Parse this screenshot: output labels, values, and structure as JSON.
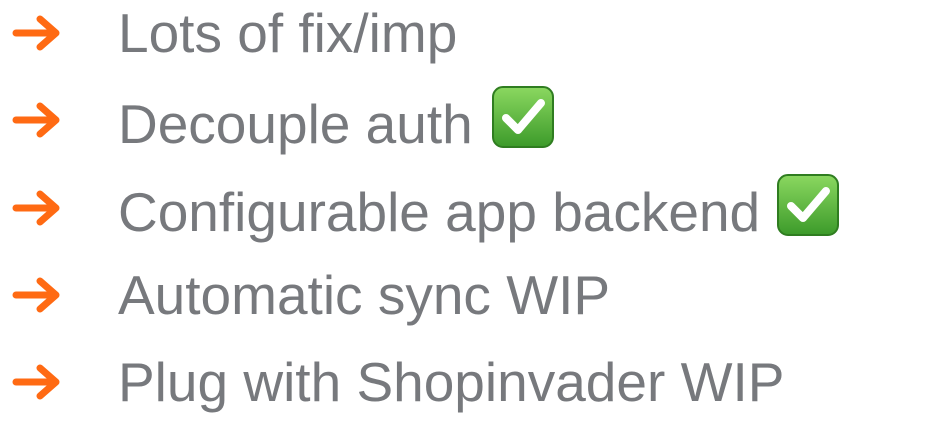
{
  "colors": {
    "arrow": "#ff6a13",
    "text": "#77797d",
    "check_box_top": "#7fd057",
    "check_box_bottom": "#3e9e2b",
    "check_mark": "#ffffff"
  },
  "items": [
    {
      "label": "Lots of fix/imp",
      "done": false,
      "icon": "arrow-right-icon"
    },
    {
      "label": "Decouple auth",
      "done": true,
      "icon": "arrow-right-icon",
      "status_icon": "check-mark-button-icon"
    },
    {
      "label": "Configurable app backend",
      "done": true,
      "icon": "arrow-right-icon",
      "status_icon": "check-mark-button-icon"
    },
    {
      "label": "Automatic sync WIP",
      "done": false,
      "icon": "arrow-right-icon"
    },
    {
      "label": "Plug with Shopinvader WIP",
      "done": false,
      "icon": "arrow-right-icon"
    }
  ]
}
